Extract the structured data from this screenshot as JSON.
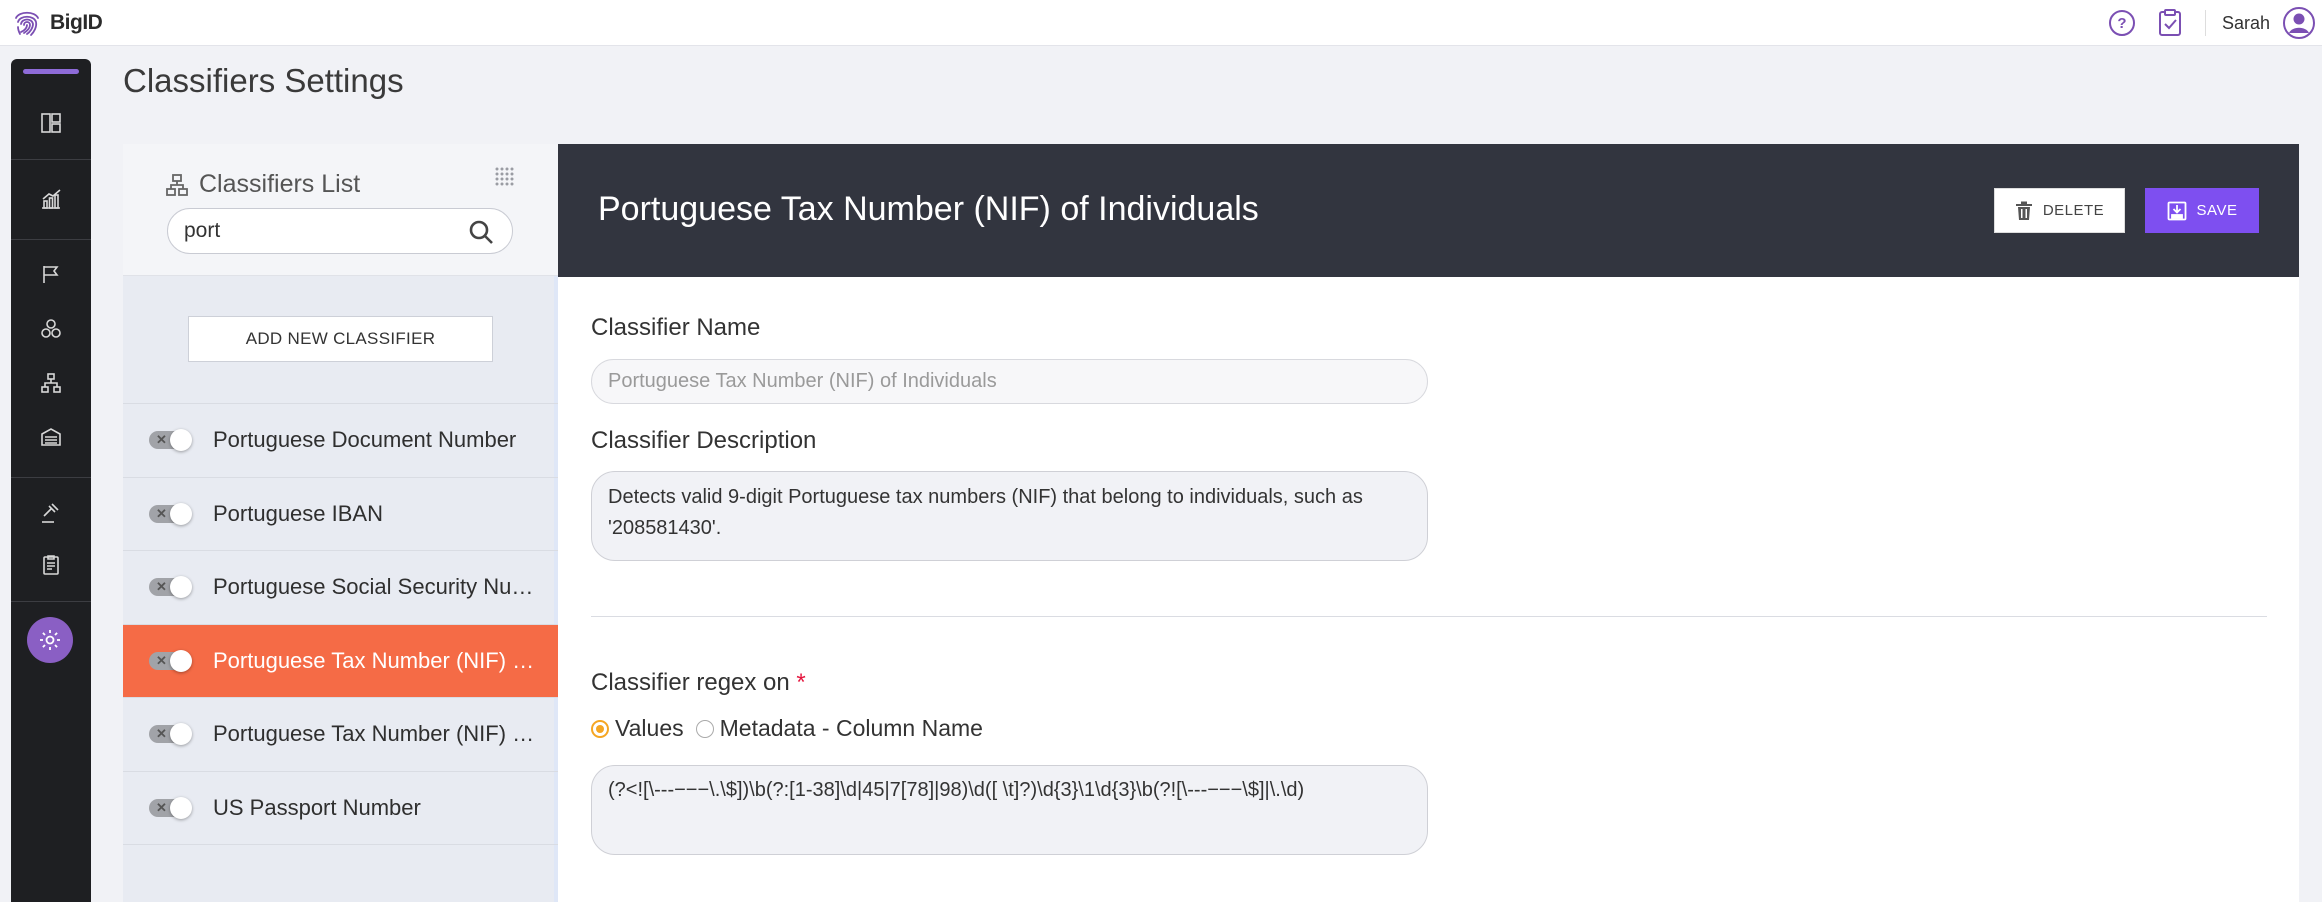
{
  "app": {
    "logo_text": "BigID",
    "user_name": "Sarah"
  },
  "page": {
    "title": "Classifiers Settings"
  },
  "classifiers_list": {
    "title": "Classifiers List",
    "search_value": "port",
    "add_button_label": "ADD NEW CLASSIFIER",
    "items": [
      {
        "label": "Portuguese Document Number",
        "enabled": false,
        "active": false
      },
      {
        "label": "Portuguese IBAN",
        "enabled": false,
        "active": false
      },
      {
        "label": "Portuguese Social Security Nu…",
        "enabled": false,
        "active": false
      },
      {
        "label": "Portuguese Tax Number (NIF) o…",
        "enabled": false,
        "active": true
      },
      {
        "label": "Portuguese Tax Number (NIF) o…",
        "enabled": false,
        "active": false
      },
      {
        "label": "US Passport Number",
        "enabled": false,
        "active": false
      }
    ]
  },
  "detail": {
    "title": "Portuguese Tax Number (NIF) of Individuals",
    "delete_label": "DELETE",
    "save_label": "SAVE",
    "name_label": "Classifier Name",
    "name_value": "Portuguese Tax Number (NIF) of Individuals",
    "description_label": "Classifier Description",
    "description_value": "Detects valid 9-digit Portuguese tax numbers (NIF) that belong to individuals, such as '208581430'.",
    "regex_on_label": "Classifier regex on",
    "required_mark": "*",
    "radio_values_label": "Values",
    "radio_metadata_label": "Metadata - Column Name",
    "regex_value": "(?<![\\---−−−\\.\\$])\\b(?:[1-38]\\d|45|7[78]|98)\\d([ \\t]?)\\d{3}\\1\\d{3}\\b(?![\\---−−−\\$]|\\.\\d)"
  },
  "colors": {
    "accent_orange": "#f56b46",
    "save_purple": "#7e4ff0",
    "header_dark": "#32353f",
    "rail": "#1e1f22"
  }
}
